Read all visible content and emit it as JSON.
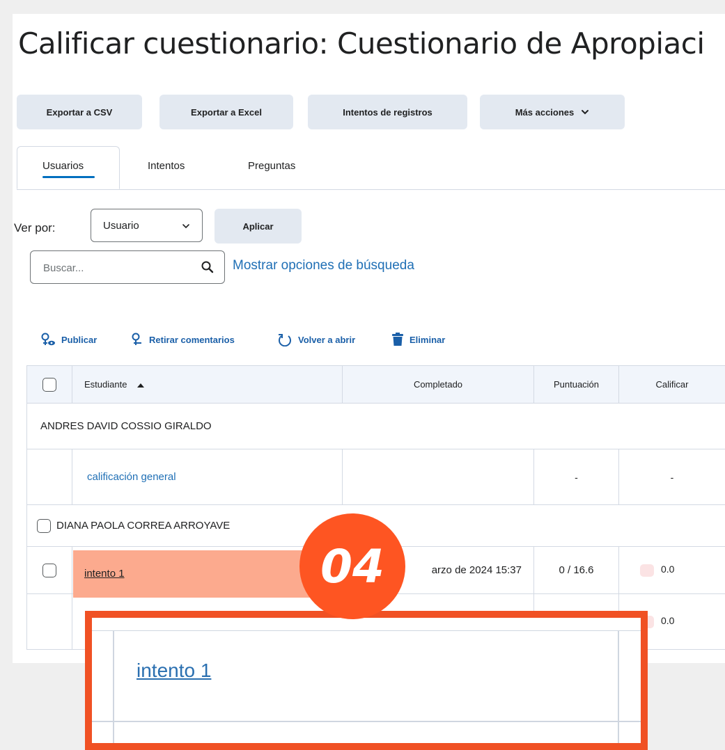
{
  "page": {
    "title": "Calificar cuestionario: Cuestionario de Apropiaci"
  },
  "toolbar": {
    "export_csv": "Exportar a CSV",
    "export_excel": "Exportar a Excel",
    "attempt_logs": "Intentos de registros",
    "more_actions": "Más acciones"
  },
  "tabs": [
    {
      "label": "Usuarios",
      "selected": true
    },
    {
      "label": "Intentos",
      "selected": false
    },
    {
      "label": "Preguntas",
      "selected": false
    }
  ],
  "filter": {
    "view_by_label": "Ver por:",
    "view_by_value": "Usuario",
    "apply_label": "Aplicar",
    "search_placeholder": "Buscar...",
    "search_options_link": "Mostrar opciones de búsqueda"
  },
  "actions": {
    "publish": "Publicar",
    "retract": "Retirar comentarios",
    "reopen": "Volver a abrir",
    "delete": "Eliminar"
  },
  "table": {
    "headers": {
      "student": "Estudiante",
      "completed": "Completado",
      "score": "Puntuación",
      "grade": "Calificar"
    },
    "groups": [
      {
        "name": "ANDRES DAVID COSSIO GIRALDO",
        "rows": [
          {
            "label": "calificación general",
            "completed": "",
            "score": "-",
            "grade": "-"
          }
        ]
      },
      {
        "name": "DIANA PAOLA CORREA ARROYAVE",
        "rows": [
          {
            "label": "intento 1",
            "completed": "arzo de 2024 15:37",
            "score": "0 / 16.6",
            "grade": "0.0"
          },
          {
            "label": "",
            "completed": "",
            "score": "",
            "grade": "0.0"
          }
        ]
      }
    ]
  },
  "overlay": {
    "step_badge": "04",
    "zoom_link": "intento 1"
  },
  "colors": {
    "accent_link": "#1f6fb5",
    "highlight": "#fcaa8e",
    "badge": "#fe5522",
    "zoom_border": "#f05124"
  }
}
